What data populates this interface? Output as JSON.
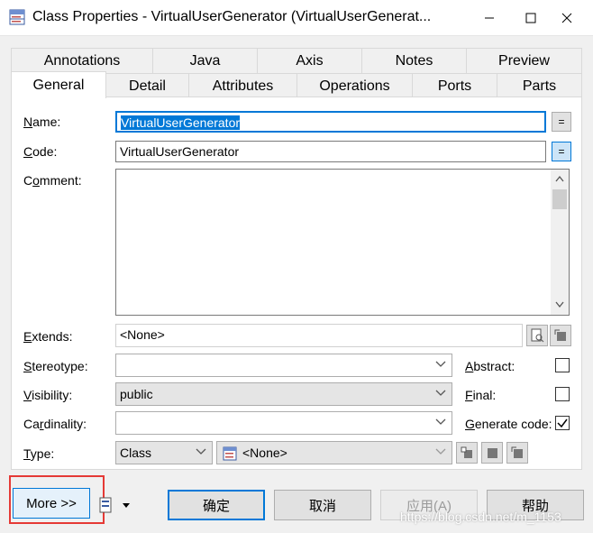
{
  "window": {
    "title": "Class Properties - VirtualUserGenerator (VirtualUserGenerat...",
    "minimize_label": "─",
    "maximize_label": "☐",
    "close_label": "✕"
  },
  "tabs": {
    "back_row": [
      "Annotations",
      "Java",
      "Axis",
      "Notes",
      "Preview"
    ],
    "front_row": [
      "General",
      "Detail",
      "Attributes",
      "Operations",
      "Ports",
      "Parts"
    ],
    "active": "General"
  },
  "form": {
    "name": {
      "label_hot": "N",
      "label_rest": "ame:",
      "value": "VirtualUserGenerator",
      "eq": "="
    },
    "code": {
      "label_hot": "C",
      "label_rest": "ode:",
      "value": "VirtualUserGenerator",
      "eq": "="
    },
    "comment": {
      "label_pre": "C",
      "label_hot": "o",
      "label_rest": "mment:",
      "value": ""
    },
    "extends": {
      "label_hot": "E",
      "label_rest": "xtends:",
      "value": "<None>"
    },
    "stereotype": {
      "label_hot": "S",
      "label_rest": "tereotype:",
      "value": ""
    },
    "visibility": {
      "label_hot": "V",
      "label_rest": "isibility:",
      "value": "public"
    },
    "cardinality": {
      "label_pre": "Ca",
      "label_hot": "r",
      "label_rest": "dinality:",
      "value": ""
    },
    "type": {
      "label_hot": "T",
      "label_rest": "ype:",
      "value": "Class",
      "classifier": "<None>"
    },
    "abstract": {
      "label_hot": "A",
      "label_rest": "bstract:",
      "checked": false
    },
    "final": {
      "label_hot": "F",
      "label_rest": "inal:",
      "checked": false
    },
    "generate_code": {
      "label_pre": "",
      "label_hot": "G",
      "label_rest": "enerate code:",
      "checked": true
    }
  },
  "buttons": {
    "more": "More >>",
    "ok": "确定",
    "cancel": "取消",
    "apply": "应用(A)",
    "help": "帮助"
  },
  "watermark": "https://blog.csdn.net/m_1153",
  "colors": {
    "accent": "#0078d7",
    "selection": "#0078d7",
    "highlight_box": "#e53935"
  }
}
